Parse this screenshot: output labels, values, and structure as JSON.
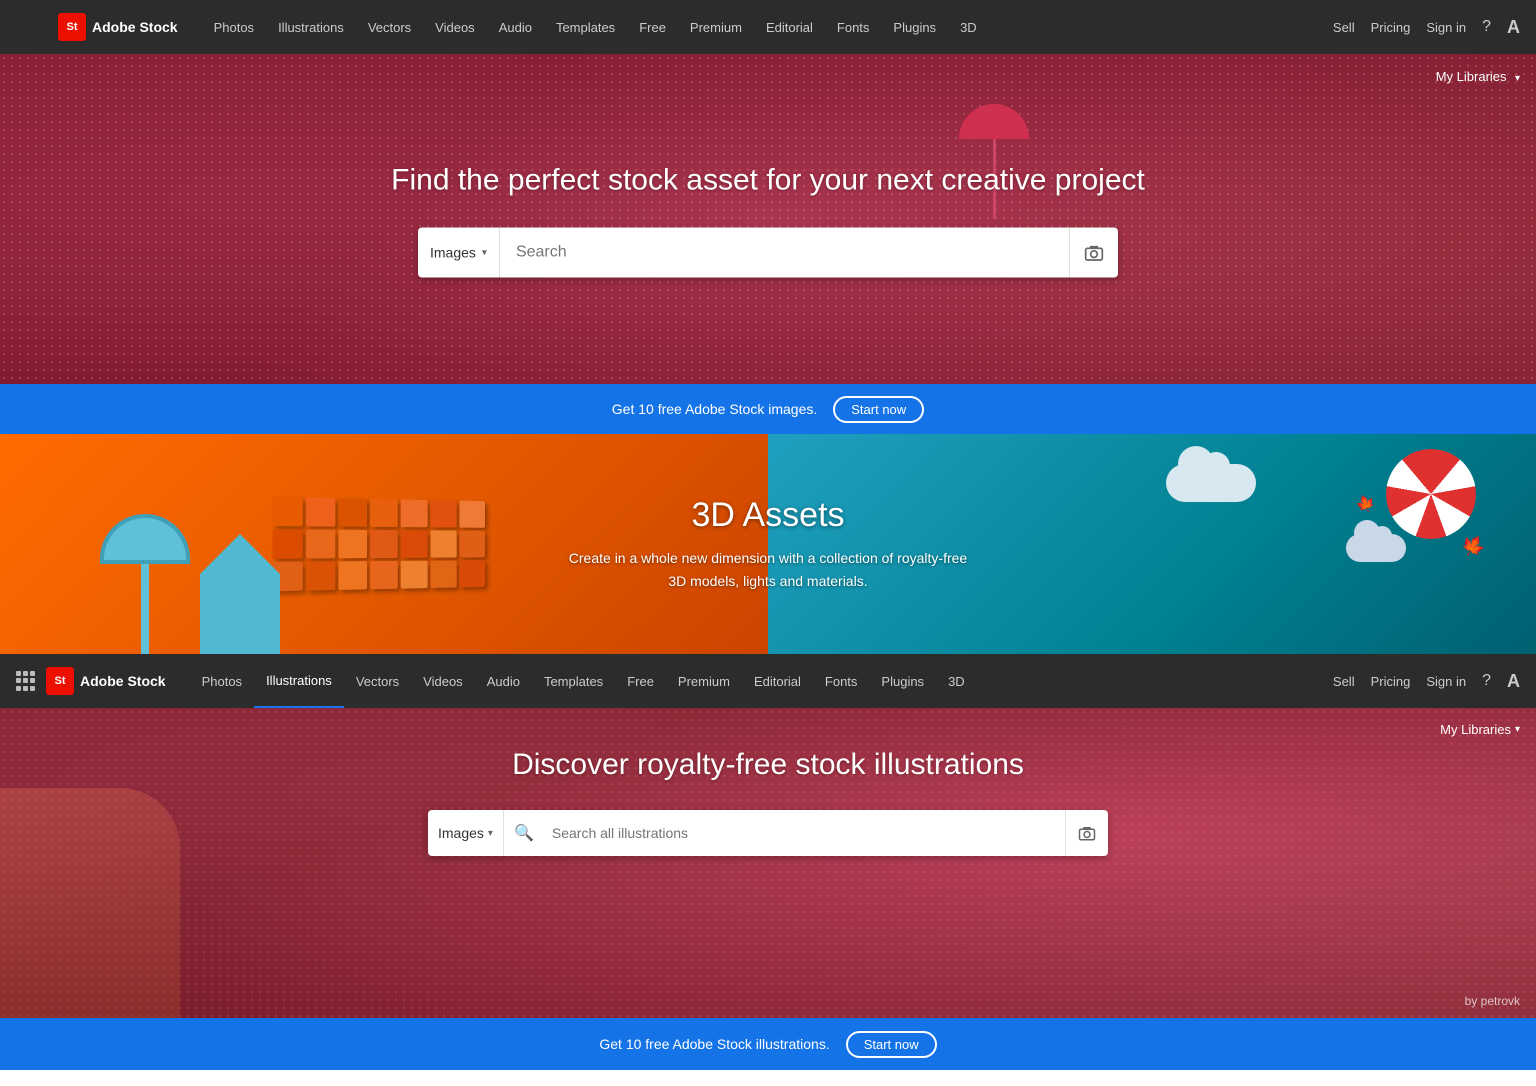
{
  "nav1": {
    "brand": "Adobe Stock",
    "logo": "St",
    "links": [
      {
        "label": "Photos",
        "active": false
      },
      {
        "label": "Illustrations",
        "active": false
      },
      {
        "label": "Vectors",
        "active": false
      },
      {
        "label": "Videos",
        "active": false
      },
      {
        "label": "Audio",
        "active": false
      },
      {
        "label": "Templates",
        "active": false
      },
      {
        "label": "Free",
        "active": false
      },
      {
        "label": "Premium",
        "active": false
      },
      {
        "label": "Editorial",
        "active": false
      },
      {
        "label": "Fonts",
        "active": false
      },
      {
        "label": "Plugins",
        "active": false
      },
      {
        "label": "3D",
        "active": false
      }
    ],
    "right_links": [
      "Sell",
      "Pricing",
      "Sign in"
    ]
  },
  "hero1": {
    "title": "Find the perfect stock asset for your next creative project",
    "search_type": "Images",
    "search_placeholder": "Search",
    "my_libraries": "My Libraries"
  },
  "promo1": {
    "text": "Get 10 free Adobe Stock images.",
    "button": "Start now"
  },
  "assets3d": {
    "title": "3D Assets",
    "description": "Create in a whole new dimension with a collection of royalty-free 3D models, lights and materials."
  },
  "nav2": {
    "brand": "Adobe Stock",
    "logo": "St",
    "links": [
      {
        "label": "Photos",
        "active": false
      },
      {
        "label": "Illustrations",
        "active": true
      },
      {
        "label": "Vectors",
        "active": false
      },
      {
        "label": "Videos",
        "active": false
      },
      {
        "label": "Audio",
        "active": false
      },
      {
        "label": "Templates",
        "active": false
      },
      {
        "label": "Free",
        "active": false
      },
      {
        "label": "Premium",
        "active": false
      },
      {
        "label": "Editorial",
        "active": false
      },
      {
        "label": "Fonts",
        "active": false
      },
      {
        "label": "Plugins",
        "active": false
      },
      {
        "label": "3D",
        "active": false
      }
    ],
    "right_links": [
      "Sell",
      "Pricing",
      "Sign in"
    ]
  },
  "hero2": {
    "title": "Discover royalty-free stock illustrations",
    "search_type": "Images",
    "search_placeholder": "Search all illustrations",
    "my_libraries": "My Libraries",
    "author": "by petrovk"
  },
  "promo2": {
    "text": "Get 10 free Adobe Stock illustrations.",
    "button": "Start now"
  }
}
